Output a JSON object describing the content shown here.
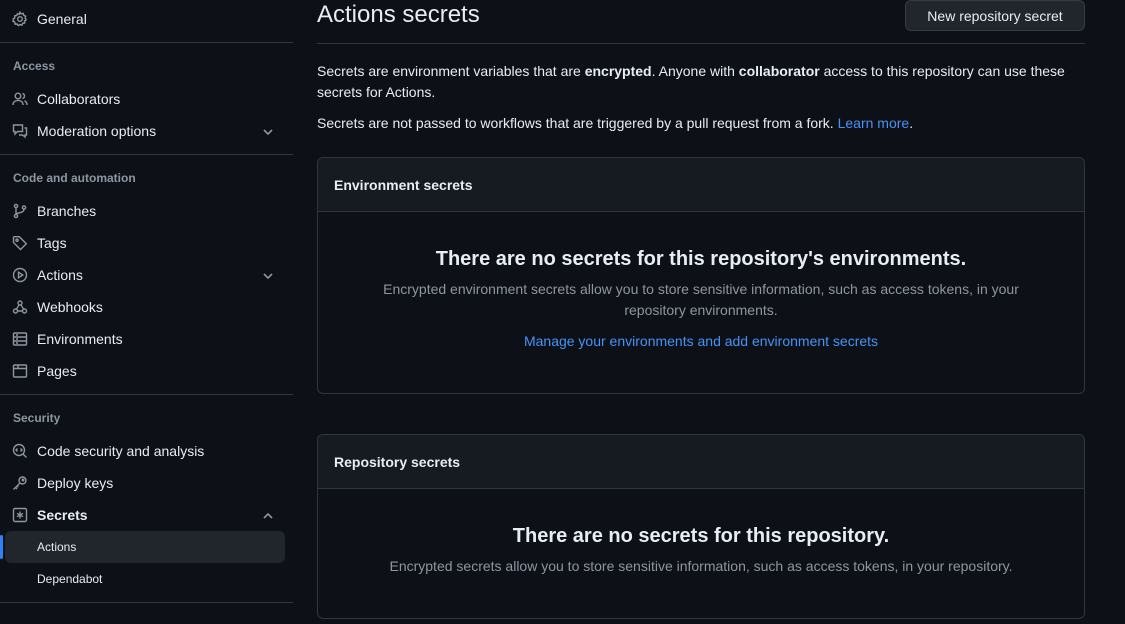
{
  "sidebar": {
    "general": "General",
    "access_title": "Access",
    "collaborators": "Collaborators",
    "moderation": "Moderation options",
    "code_title": "Code and automation",
    "branches": "Branches",
    "tags": "Tags",
    "actions": "Actions",
    "webhooks": "Webhooks",
    "environments": "Environments",
    "pages": "Pages",
    "security_title": "Security",
    "code_security": "Code security and analysis",
    "deploy_keys": "Deploy keys",
    "secrets": "Secrets",
    "secrets_actions": "Actions",
    "secrets_dependabot": "Dependabot"
  },
  "main": {
    "title": "Actions secrets",
    "new_button": "New repository secret",
    "intro_1a": "Secrets are environment variables that are ",
    "intro_1b": "encrypted",
    "intro_1c": ". Anyone with ",
    "intro_1d": "collaborator",
    "intro_1e": " access to this repository can use these secrets for Actions.",
    "intro_2a": "Secrets are not passed to workflows that are triggered by a pull request from a fork. ",
    "intro_2_link": "Learn more",
    "intro_2b": ".",
    "env_box": {
      "header": "Environment secrets",
      "empty_title": "There are no secrets for this repository's environments.",
      "empty_desc": "Encrypted environment secrets allow you to store sensitive information, such as access tokens, in your repository environments.",
      "link": "Manage your environments and add environment secrets"
    },
    "repo_box": {
      "header": "Repository secrets",
      "empty_title": "There are no secrets for this repository.",
      "empty_desc": "Encrypted secrets allow you to store sensitive information, such as access tokens, in your repository."
    }
  },
  "colors": {
    "background": "#0d1117",
    "panel": "#161b22",
    "border": "#30363d",
    "link": "#4493f8",
    "accent": "#2f81f7",
    "muted": "#8d96a0"
  }
}
